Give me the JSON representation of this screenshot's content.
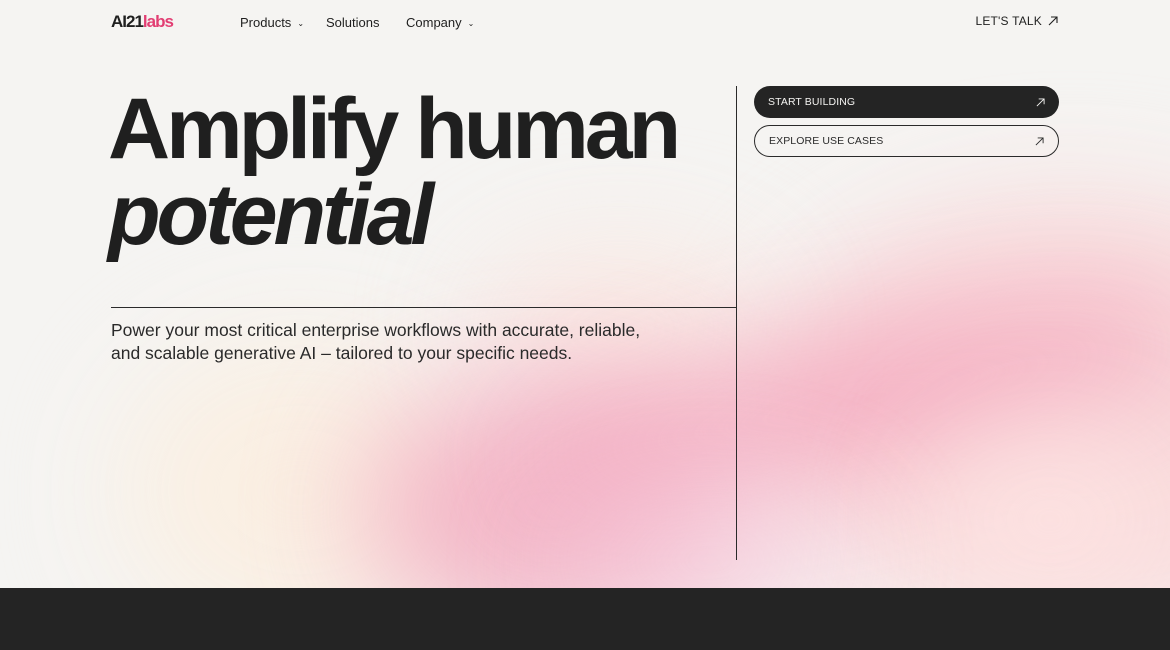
{
  "nav": {
    "logo_main": "AI21",
    "logo_accent": "labs",
    "items": [
      {
        "label": "Products",
        "has_dropdown": true
      },
      {
        "label": "Solutions",
        "has_dropdown": false
      },
      {
        "label": "Company",
        "has_dropdown": true
      }
    ],
    "cta_label": "LET'S TALK",
    "cta_icon": "arrow-up-right-icon"
  },
  "hero": {
    "headline_line1": "Amplify human",
    "headline_line2": "potential",
    "subtitle": "Power your most critical enterprise workflows with accurate, reliable, and scalable generative AI – tailored to your specific needs.",
    "primary_button": "START BUILDING",
    "secondary_button": "EXPLORE USE CASES"
  },
  "colors": {
    "text": "#1f1f1f",
    "background": "#f5f4f2",
    "brand_accent": "#e23e73",
    "dark_band": "#242424",
    "gradient_pink": "#f4a9bf"
  }
}
